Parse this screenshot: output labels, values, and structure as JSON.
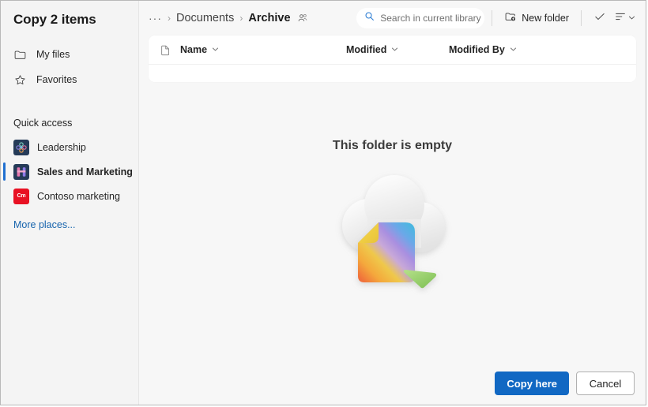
{
  "dialog": {
    "title": "Copy 2 items"
  },
  "sidebar": {
    "nav": [
      {
        "label": "My files",
        "icon": "folder-icon"
      },
      {
        "label": "Favorites",
        "icon": "star-icon"
      }
    ],
    "quick_access_heading": "Quick access",
    "quick_access": [
      {
        "label": "Leadership",
        "icon": "leadership-site-icon",
        "selected": false
      },
      {
        "label": "Sales and Marketing",
        "icon": "sales-marketing-site-icon",
        "selected": true
      },
      {
        "label": "Contoso marketing",
        "icon": "contoso-marketing-site-icon",
        "badge": "Cm",
        "selected": false
      }
    ],
    "more_places": "More places..."
  },
  "breadcrumb": {
    "overflow": "···",
    "separator": "›",
    "items": [
      {
        "label": "Documents",
        "current": false
      },
      {
        "label": "Archive",
        "current": true
      }
    ],
    "shared_icon": "people-shared-icon"
  },
  "toolbar": {
    "search_placeholder": "Search in current library",
    "search_icon": "search-icon",
    "new_folder_label": "New folder",
    "new_folder_icon": "new-folder-icon",
    "select_icon": "checkmark-icon",
    "sort_icon": "sort-list-icon",
    "sort_chevron": "chevron-down-icon"
  },
  "columns": [
    {
      "label": "Name",
      "chevron": "chevron-down-icon"
    },
    {
      "label": "Modified",
      "chevron": "chevron-down-icon"
    },
    {
      "label": "Modified By",
      "chevron": "chevron-down-icon"
    }
  ],
  "empty_state": {
    "title": "This folder is empty",
    "illustration": "cloud-with-file-and-cursor-illustration"
  },
  "footer": {
    "primary_label": "Copy here",
    "secondary_label": "Cancel"
  },
  "colors": {
    "accent": "#1168c3",
    "selection_bar": "#1f6fd0",
    "link": "#1764ad",
    "search_icon": "#2b7cd3",
    "sidebar_bg": "#f4f4f4",
    "main_bg": "#f7f7f7",
    "card_bg": "#ffffff",
    "site_navy": "#253b58",
    "site_red": "#e81123"
  }
}
